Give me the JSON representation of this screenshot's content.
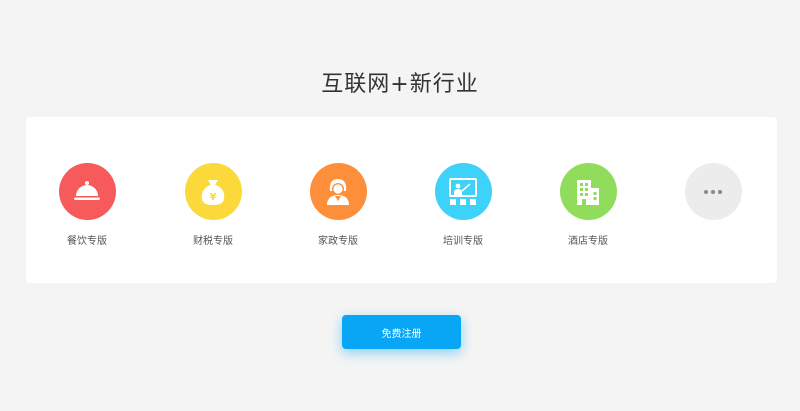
{
  "title": "互联网+新行业",
  "industries": [
    {
      "label": "餐饮专版",
      "icon": "food-cloche-icon",
      "color": "#f65a5a"
    },
    {
      "label": "财税专版",
      "icon": "money-bag-icon",
      "color": "#fcd93a"
    },
    {
      "label": "家政专版",
      "icon": "housekeeper-icon",
      "color": "#fd8f3a"
    },
    {
      "label": "培训专版",
      "icon": "training-board-icon",
      "color": "#3fd2f8"
    },
    {
      "label": "酒店专版",
      "icon": "hotel-building-icon",
      "color": "#8fdd5b"
    },
    {
      "label": "",
      "icon": "more-dots-icon",
      "color": "#ececec"
    }
  ],
  "money_symbol": "¥",
  "register_button": {
    "label": "免费注册",
    "color": "#0aa6f6"
  }
}
